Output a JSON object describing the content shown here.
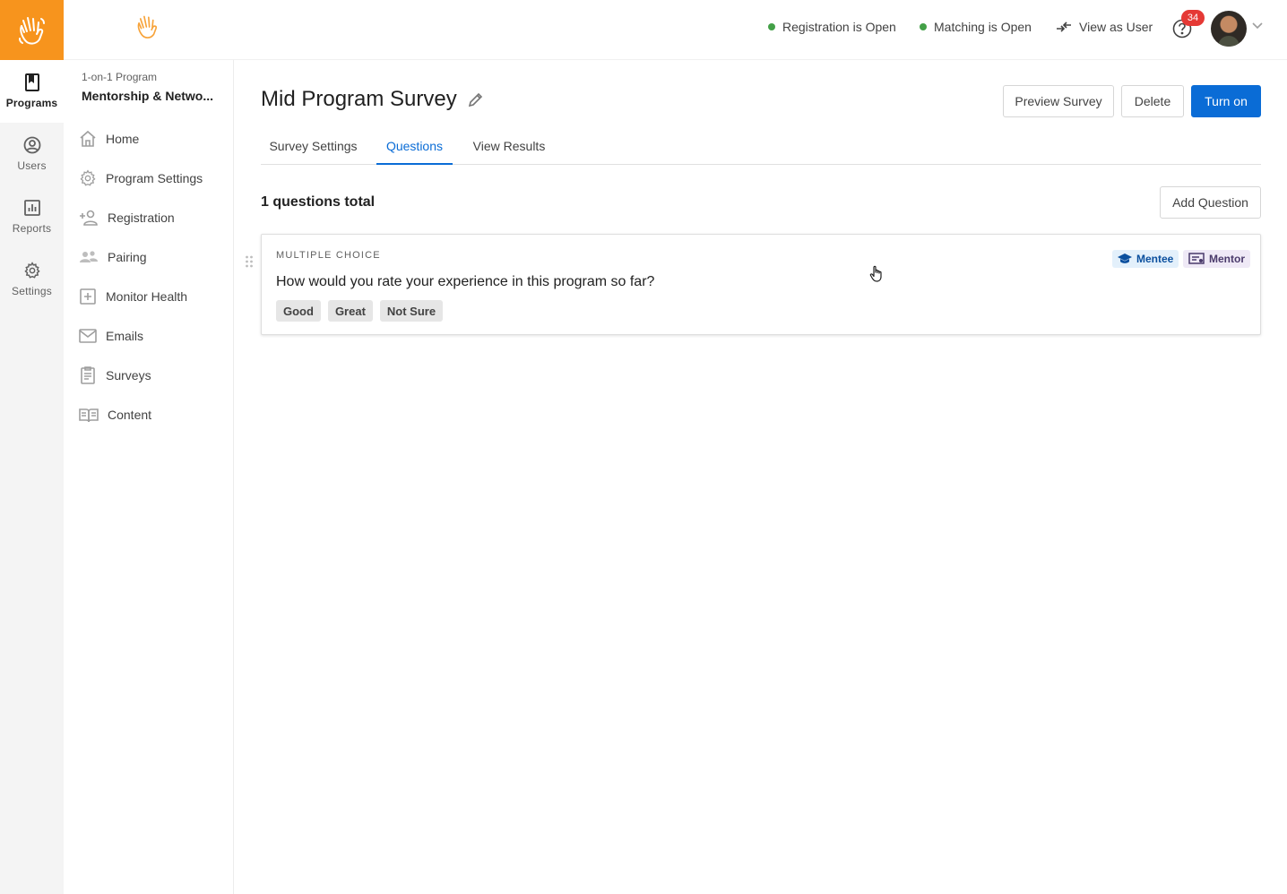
{
  "rail": {
    "items": [
      {
        "label": "Programs",
        "icon": "book-icon",
        "active": true
      },
      {
        "label": "Users",
        "icon": "user-circle-icon",
        "active": false
      },
      {
        "label": "Reports",
        "icon": "bar-chart-icon",
        "active": false
      },
      {
        "label": "Settings",
        "icon": "gear-icon",
        "active": false
      }
    ]
  },
  "header": {
    "registration_status": "Registration is Open",
    "matching_status": "Matching is Open",
    "view_as_user": "View as User",
    "notification_count": "34",
    "status_color": "#43a047",
    "brand_color": "#f7941d"
  },
  "program": {
    "type": "1-on-1 Program",
    "name": "Mentorship & Netwo..."
  },
  "sidenav": {
    "items": [
      {
        "label": "Home",
        "icon": "home-icon"
      },
      {
        "label": "Program Settings",
        "icon": "gear-icon"
      },
      {
        "label": "Registration",
        "icon": "add-user-icon"
      },
      {
        "label": "Pairing",
        "icon": "users-icon"
      },
      {
        "label": "Monitor Health",
        "icon": "plus-square-icon"
      },
      {
        "label": "Emails",
        "icon": "envelope-icon"
      },
      {
        "label": "Surveys",
        "icon": "clipboard-icon"
      },
      {
        "label": "Content",
        "icon": "open-book-icon"
      }
    ]
  },
  "page": {
    "title": "Mid Program Survey",
    "buttons": {
      "preview": "Preview Survey",
      "delete": "Delete",
      "turn_on": "Turn on"
    },
    "tabs": [
      {
        "label": "Survey Settings",
        "active": false
      },
      {
        "label": "Questions",
        "active": true
      },
      {
        "label": "View Results",
        "active": false
      }
    ],
    "questions_total": "1 questions total",
    "add_question": "Add Question",
    "accent_color": "#0a6cd6"
  },
  "question": {
    "type": "MULTIPLE CHOICE",
    "text": "How would you rate your experience in this program so far?",
    "options": [
      "Good",
      "Great",
      "Not Sure"
    ],
    "roles": [
      "Mentee",
      "Mentor"
    ]
  }
}
